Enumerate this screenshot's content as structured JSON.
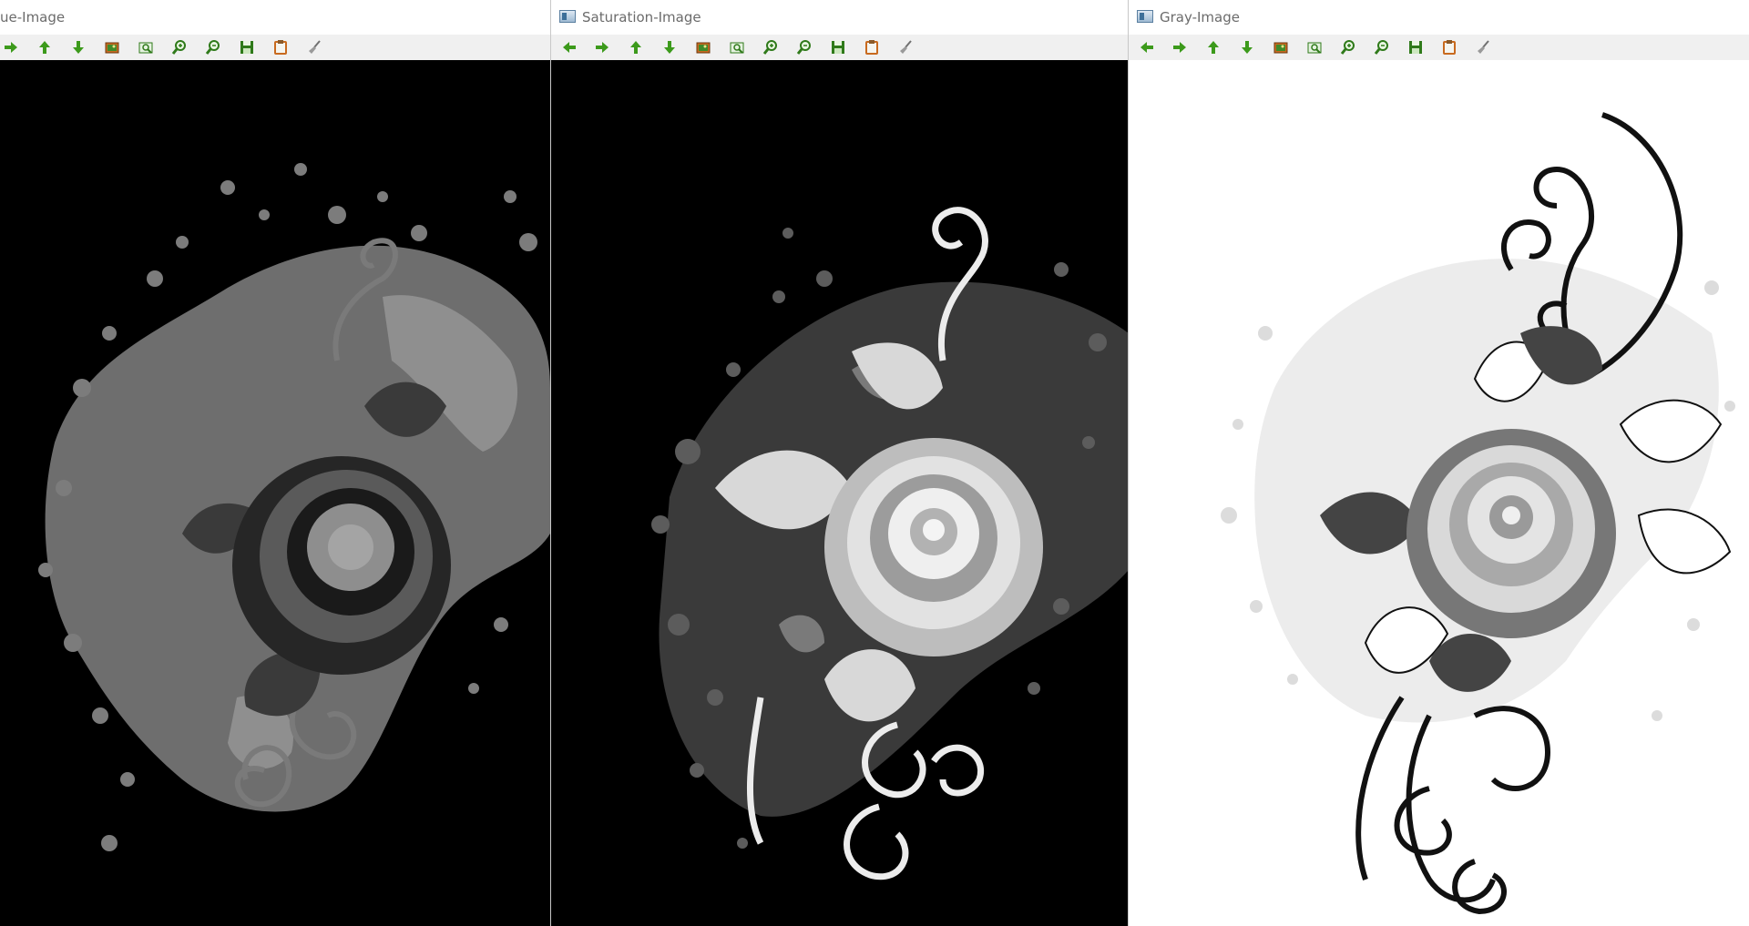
{
  "windows": [
    {
      "id": "hue",
      "title": "ue-Image"
    },
    {
      "id": "sat",
      "title": "Saturation-Image"
    },
    {
      "id": "gray",
      "title": "Gray-Image"
    }
  ],
  "toolbar_icons": [
    "arrow-left-icon",
    "arrow-right-icon",
    "arrow-up-icon",
    "arrow-down-icon",
    "zoom-fit-icon",
    "zoom-original-icon",
    "zoom-in-icon",
    "zoom-out-icon",
    "save-icon",
    "copy-icon",
    "properties-icon"
  ],
  "colors": {
    "arrow_green": "#3c9a1b",
    "hue_bg": "#000000",
    "saturation_bg": "#000000",
    "gray_bg": "#ffffff"
  }
}
